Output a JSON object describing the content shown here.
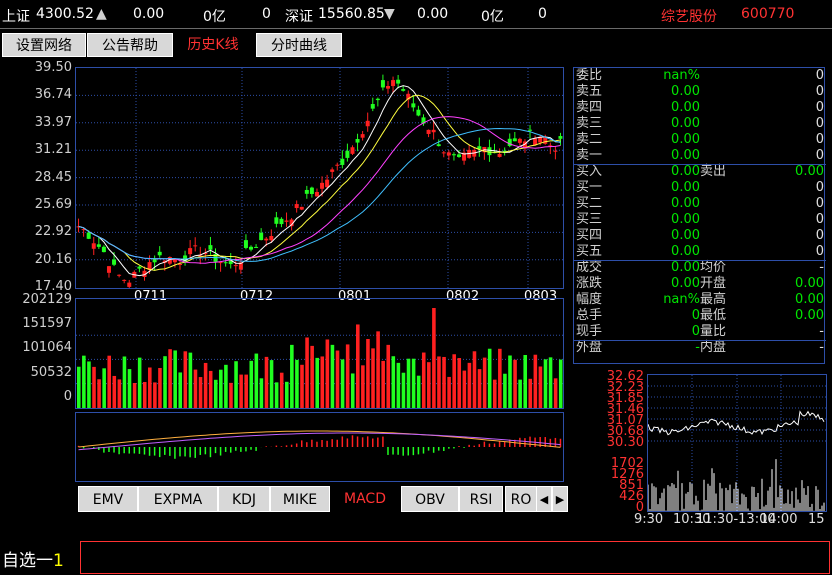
{
  "ticker": {
    "sh_name": "上证",
    "sh_value": "4300.52",
    "sh_arrow": "▲",
    "sh_change": "0.00",
    "sh_volume": "0亿",
    "sh_extra": "0",
    "sz_name": "深证",
    "sz_value": "15560.85",
    "sz_arrow": "▼",
    "sz_change": "0.00",
    "sz_volume": "0亿",
    "sz_extra": "0",
    "stock_name": "综艺股份",
    "stock_code": "600770"
  },
  "tabs": [
    {
      "label": "设置网络"
    },
    {
      "label": "公告帮助"
    },
    {
      "label": "历史K线"
    },
    {
      "label": "分时曲线"
    }
  ],
  "kline": {
    "y_ticks": [
      "39.50",
      "36.74",
      "33.97",
      "31.21",
      "28.45",
      "25.69",
      "22.92",
      "20.16",
      "17.40"
    ],
    "x_ticks": [
      "0711",
      "0712",
      "0801",
      "0802",
      "0803"
    ]
  },
  "volume": {
    "y_ticks": [
      "202129",
      "151597",
      "101064",
      "50532",
      "0"
    ]
  },
  "colors": {
    "up": "#ff2020",
    "down": "#20ff20",
    "frame": "#2d4ea8",
    "ma1": "#ffffff",
    "ma2": "#ffff40",
    "ma3": "#ff40ff",
    "ma4": "#40c0ff"
  },
  "quote": {
    "rows": [
      {
        "label": "委比",
        "value": "nan%",
        "label2": "",
        "value2": "0"
      },
      {
        "label": "卖五",
        "value": "0.00",
        "label2": "",
        "value2": "0"
      },
      {
        "label": "卖四",
        "value": "0.00",
        "label2": "",
        "value2": "0"
      },
      {
        "label": "卖三",
        "value": "0.00",
        "label2": "",
        "value2": "0"
      },
      {
        "label": "卖二",
        "value": "0.00",
        "label2": "",
        "value2": "0"
      },
      {
        "label": "卖一",
        "value": "0.00",
        "label2": "",
        "value2": "0"
      },
      {
        "label": "买入",
        "value": "0.00",
        "label2": "卖出",
        "value2": "0.00"
      },
      {
        "label": "买一",
        "value": "0.00",
        "label2": "",
        "value2": "0"
      },
      {
        "label": "买二",
        "value": "0.00",
        "label2": "",
        "value2": "0"
      },
      {
        "label": "买三",
        "value": "0.00",
        "label2": "",
        "value2": "0"
      },
      {
        "label": "买四",
        "value": "0.00",
        "label2": "",
        "value2": "0"
      },
      {
        "label": "买五",
        "value": "0.00",
        "label2": "",
        "value2": "0"
      },
      {
        "label": "成交",
        "value": "0.00",
        "label2": "均价",
        "value2": "-"
      },
      {
        "label": "涨跌",
        "value": "0.00",
        "label2": "开盘",
        "value2": "0.00"
      },
      {
        "label": "幅度",
        "value": "nan%",
        "label2": "最高",
        "value2": "0.00"
      },
      {
        "label": "总手",
        "value": "0",
        "label2": "最低",
        "value2": "0.00"
      },
      {
        "label": "现手",
        "value": "0",
        "label2": "量比",
        "value2": "-"
      },
      {
        "label": "外盘",
        "value": "-",
        "label2": "内盘",
        "value2": "-"
      }
    ]
  },
  "intraday": {
    "price_ticks": [
      "32.62",
      "32.23",
      "31.85",
      "31.46",
      "31.07",
      "30.68",
      "30.30"
    ],
    "volume_ticks": [
      "1702",
      "1276",
      "851",
      "426",
      "0"
    ],
    "time_ticks": [
      "9:30",
      "10:30",
      "11:30-13:00",
      "14:00",
      "15"
    ]
  },
  "indicator_tabs": [
    {
      "label": "EMV"
    },
    {
      "label": "EXPMA"
    },
    {
      "label": "KDJ"
    },
    {
      "label": "MIKE"
    },
    {
      "label": "MACD"
    },
    {
      "label": "OBV"
    },
    {
      "label": "RSI"
    },
    {
      "label": "RO"
    }
  ],
  "scroll": {
    "left": "◀",
    "right": "▶"
  },
  "watchlist": {
    "label": "自选一",
    "number": "1",
    "input": ""
  }
}
